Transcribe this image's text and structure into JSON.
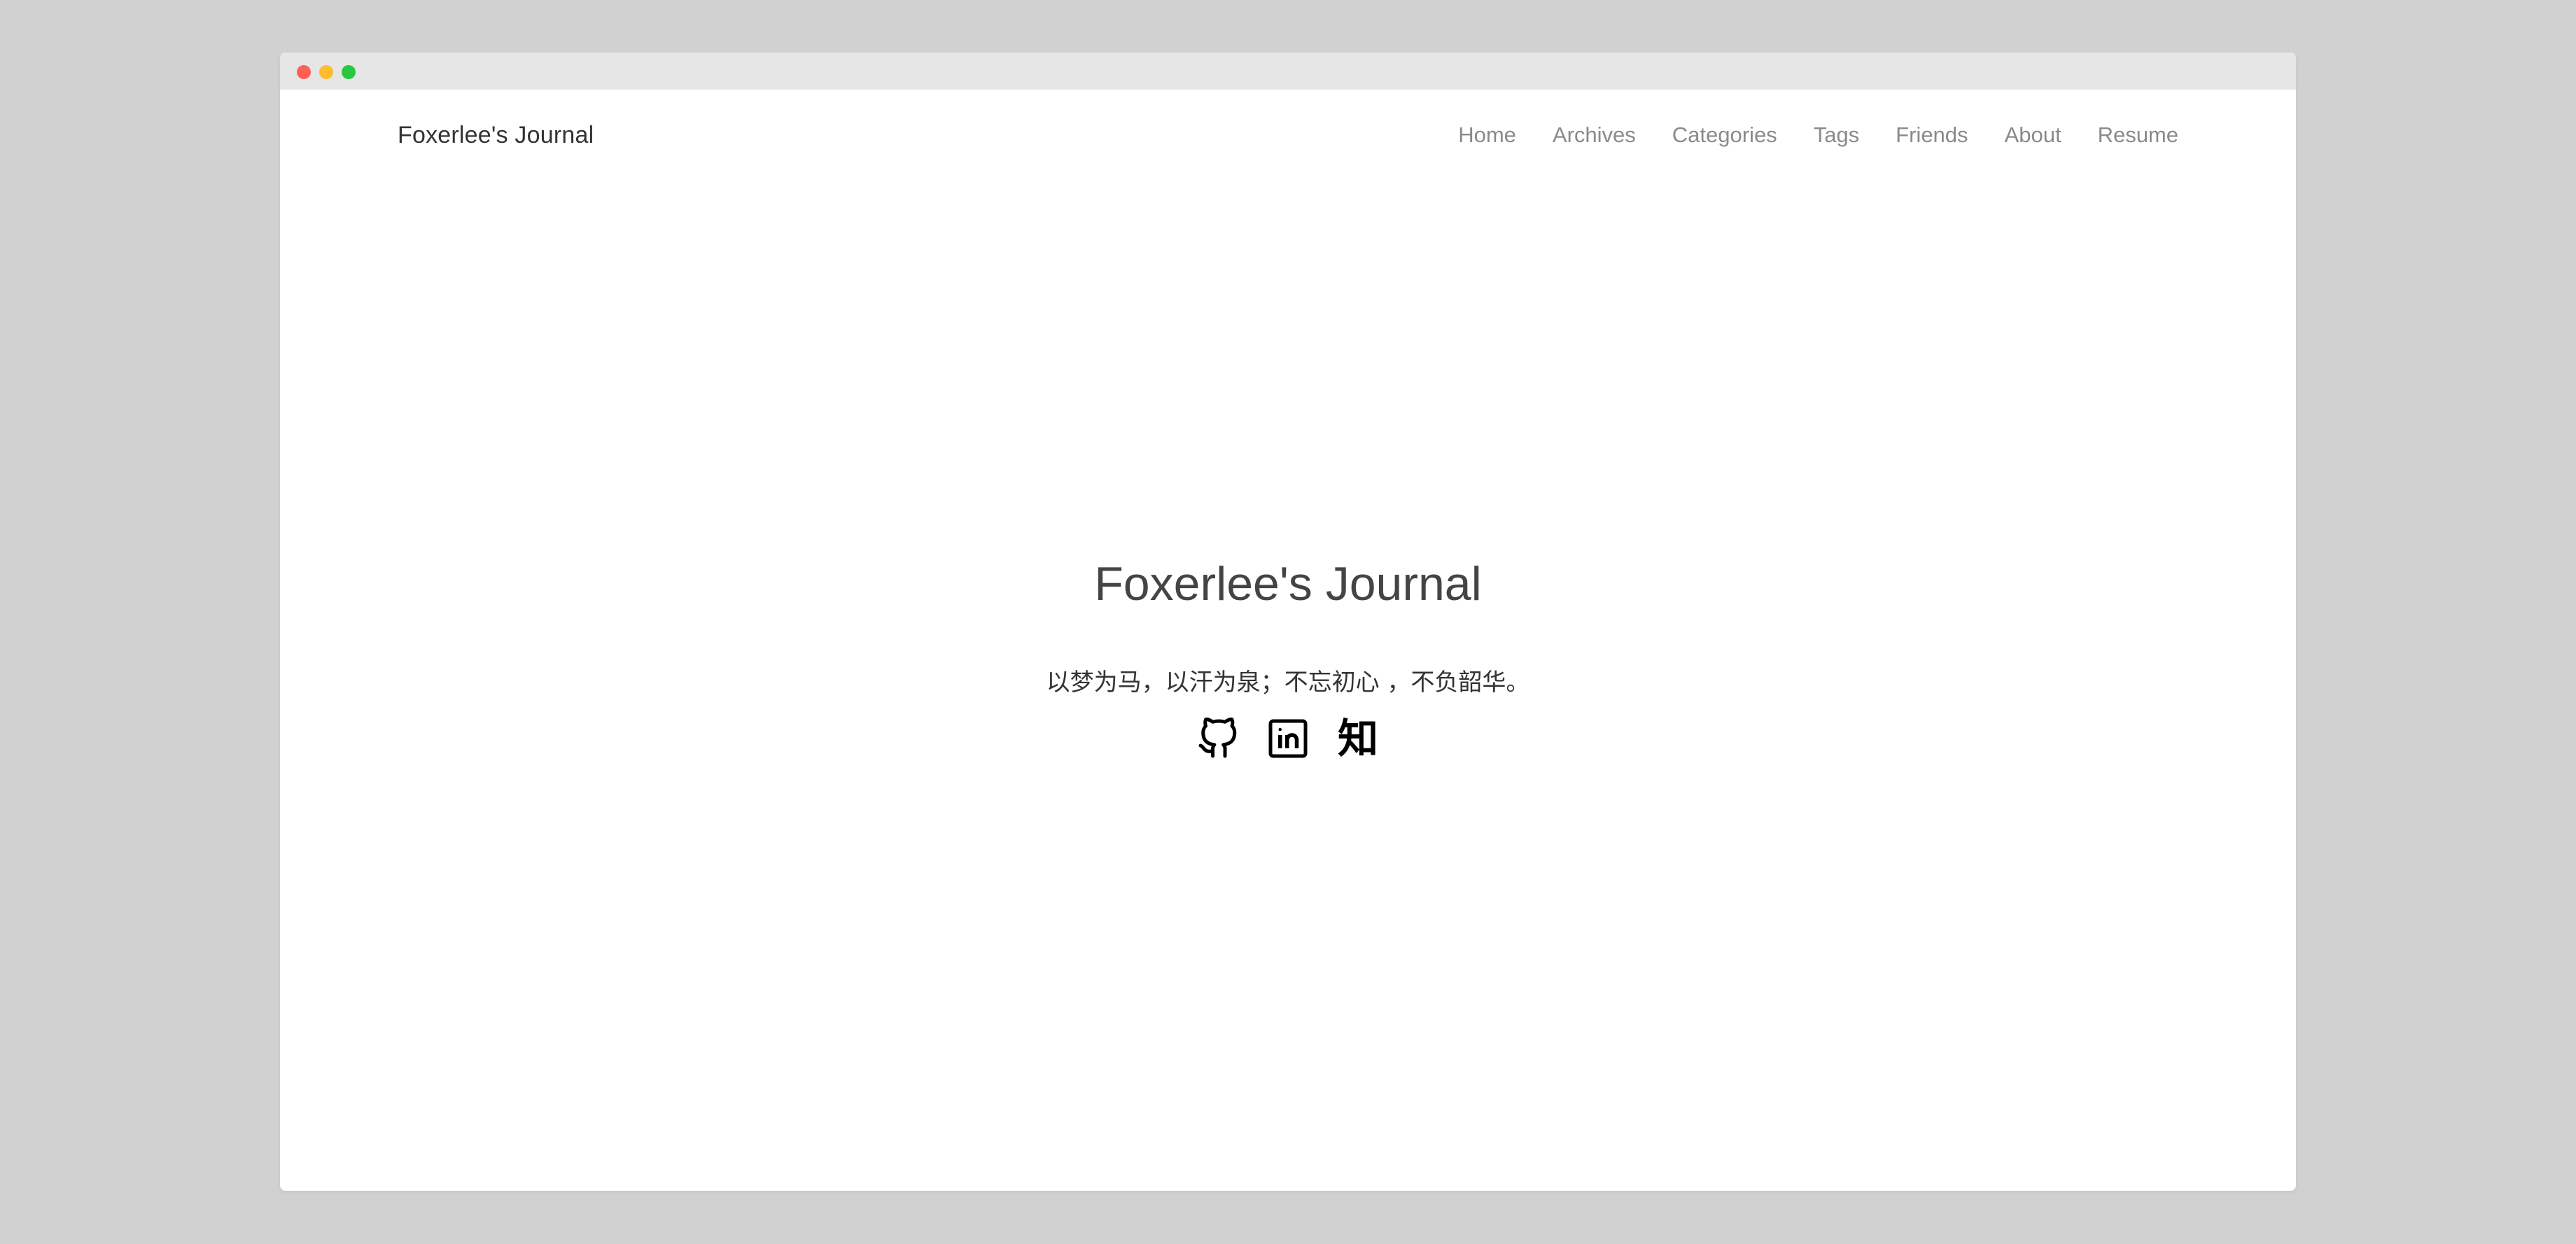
{
  "window": {
    "controls": [
      "close",
      "minimize",
      "maximize"
    ],
    "colors": {
      "close": "#ff5f57",
      "minimize": "#febc2e",
      "maximize": "#28c840"
    }
  },
  "navbar": {
    "brand": "Foxerlee's Journal",
    "items": [
      {
        "label": "Home"
      },
      {
        "label": "Archives"
      },
      {
        "label": "Categories"
      },
      {
        "label": "Tags"
      },
      {
        "label": "Friends"
      },
      {
        "label": "About"
      },
      {
        "label": "Resume"
      }
    ]
  },
  "hero": {
    "title": "Foxerlee's Journal",
    "subtitle": "以梦为马，以汗为泉；不忘初心 ，不负韶华。",
    "social": [
      {
        "name": "github",
        "icon": "github-icon"
      },
      {
        "name": "linkedin",
        "icon": "linkedin-icon"
      },
      {
        "name": "zhihu",
        "icon": "zhihu-icon",
        "glyph": "知"
      }
    ]
  }
}
